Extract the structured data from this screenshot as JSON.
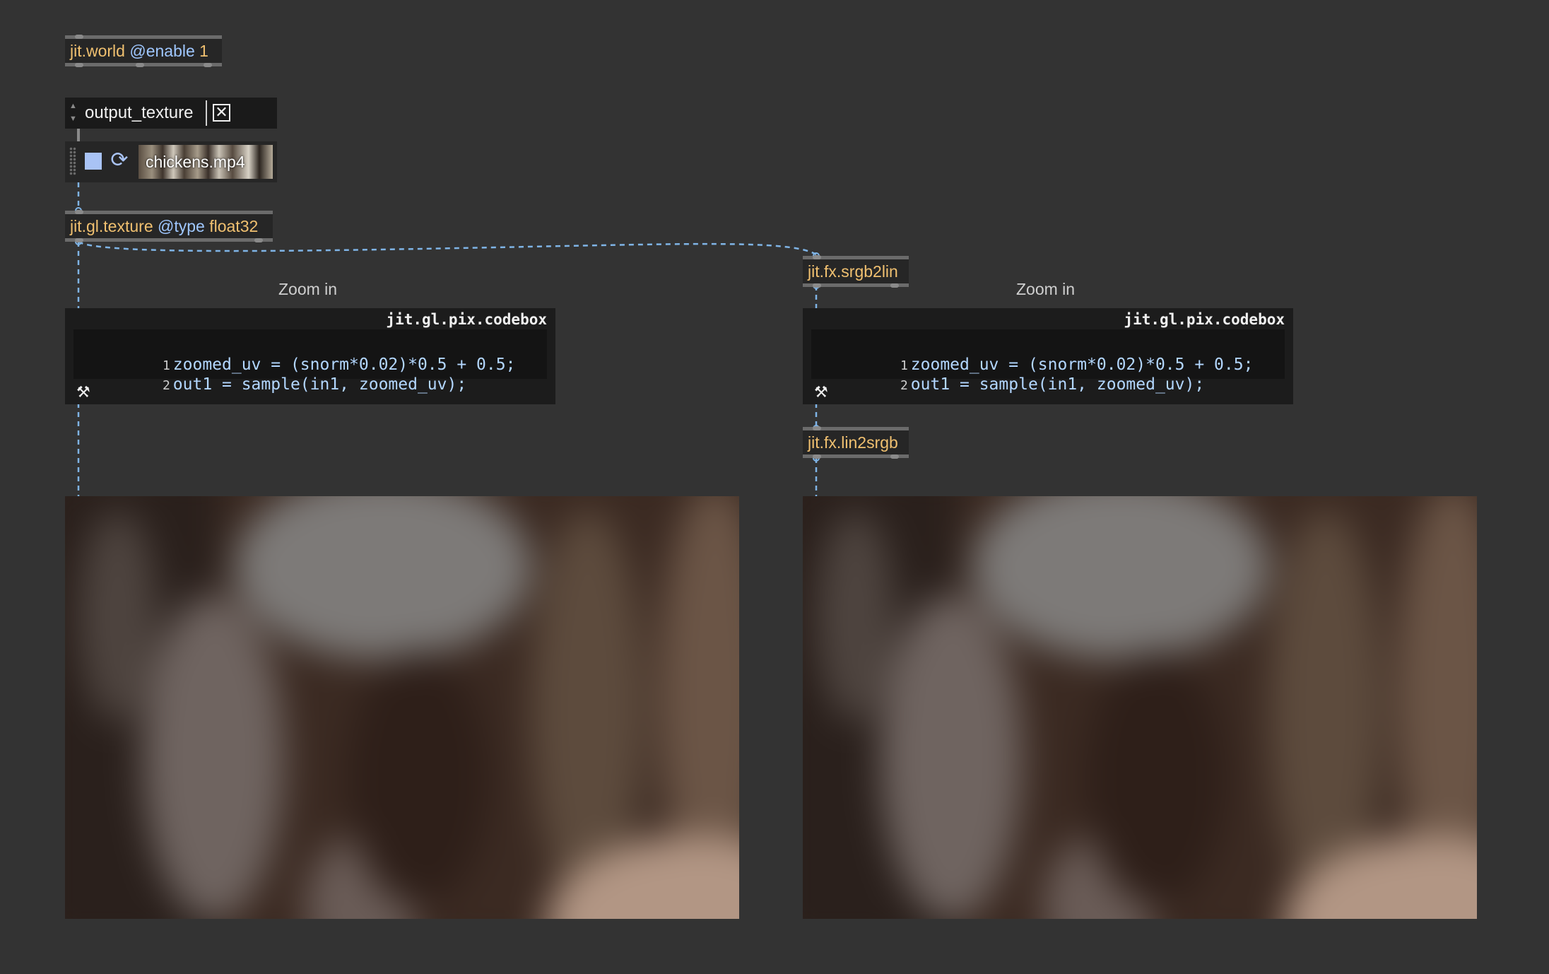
{
  "objects": {
    "world": {
      "name": "jit.world",
      "attr": "@enable",
      "value": "1"
    },
    "texture": {
      "name": "jit.gl.texture",
      "attr": "@type",
      "value": "float32"
    },
    "srgb2lin": {
      "name": "jit.fx.srgb2lin"
    },
    "lin2srgb": {
      "name": "jit.fx.lin2srgb"
    }
  },
  "umenu": {
    "selected": "output_texture",
    "clear_glyph": "✕"
  },
  "player": {
    "filename": "chickens.mp4"
  },
  "comments": {
    "left": "Zoom in",
    "right": "Zoom in"
  },
  "codeboxes": [
    {
      "title": "jit.gl.pix.codebox",
      "lines": [
        "zoomed_uv = (snorm*0.02)*0.5 + 0.5;",
        "out1 = sample(in1, zoomed_uv);"
      ]
    },
    {
      "title": "jit.gl.pix.codebox",
      "lines": [
        "zoomed_uv = (snorm*0.02)*0.5 + 0.5;",
        "out1 = sample(in1, zoomed_uv);"
      ]
    }
  ],
  "colors": {
    "background": "#333333",
    "object_text": "#f0c070",
    "attribute_text": "#9fc7ff",
    "cable": "#7fb4e6"
  },
  "icons": {
    "umenu_arrows": "updown-arrows-icon",
    "clear": "close-box-icon",
    "stop": "stop-square-icon",
    "loop": "loop-icon",
    "build": "hammer-icon"
  }
}
